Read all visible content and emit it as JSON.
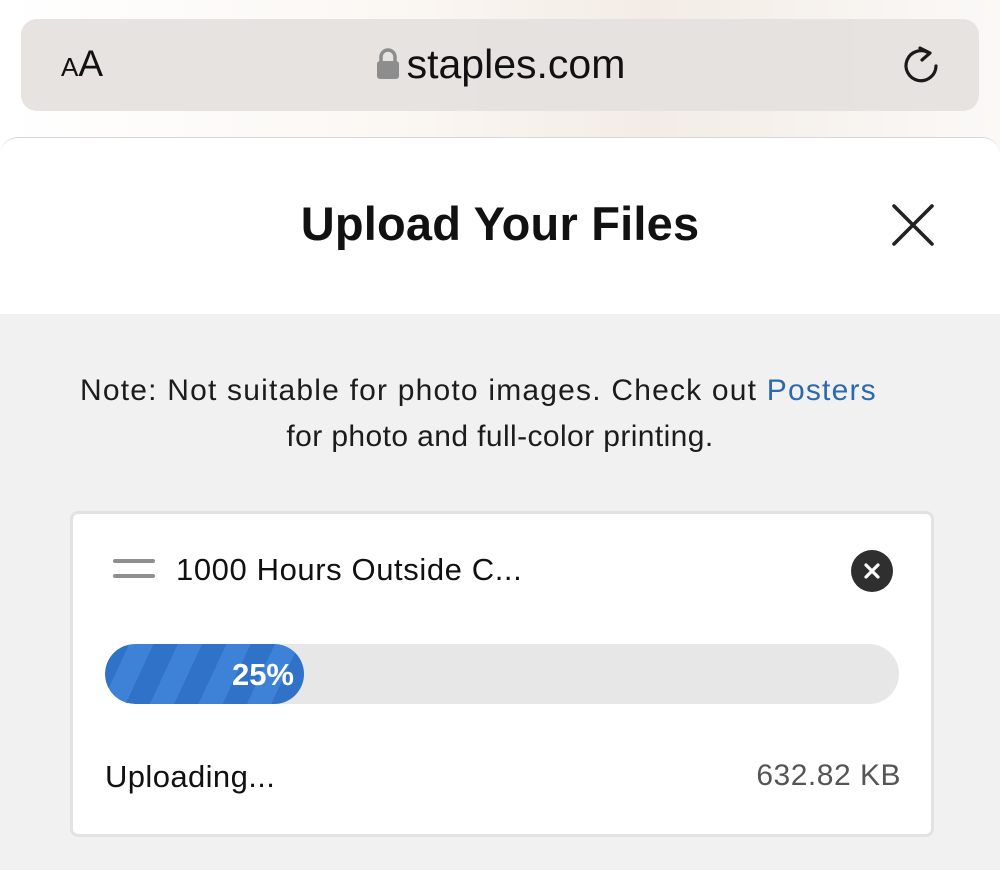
{
  "browser": {
    "text_size_small": "A",
    "text_size_large": "A",
    "domain": "staples.com"
  },
  "modal": {
    "title": "Upload Your Files",
    "note_prefix": "Note: Not suitable for photo images. Check out ",
    "note_link": "Posters",
    "note_suffix": "for photo and full-color printing."
  },
  "upload": {
    "file_name": "1000 Hours Outside C...",
    "progress_percent": 25,
    "progress_label": "25%",
    "status": "Uploading...",
    "file_size": "632.82 KB"
  },
  "colors": {
    "link": "#2c6aab",
    "progress": "#2f72c7",
    "remove_button": "#2f2f2f"
  }
}
